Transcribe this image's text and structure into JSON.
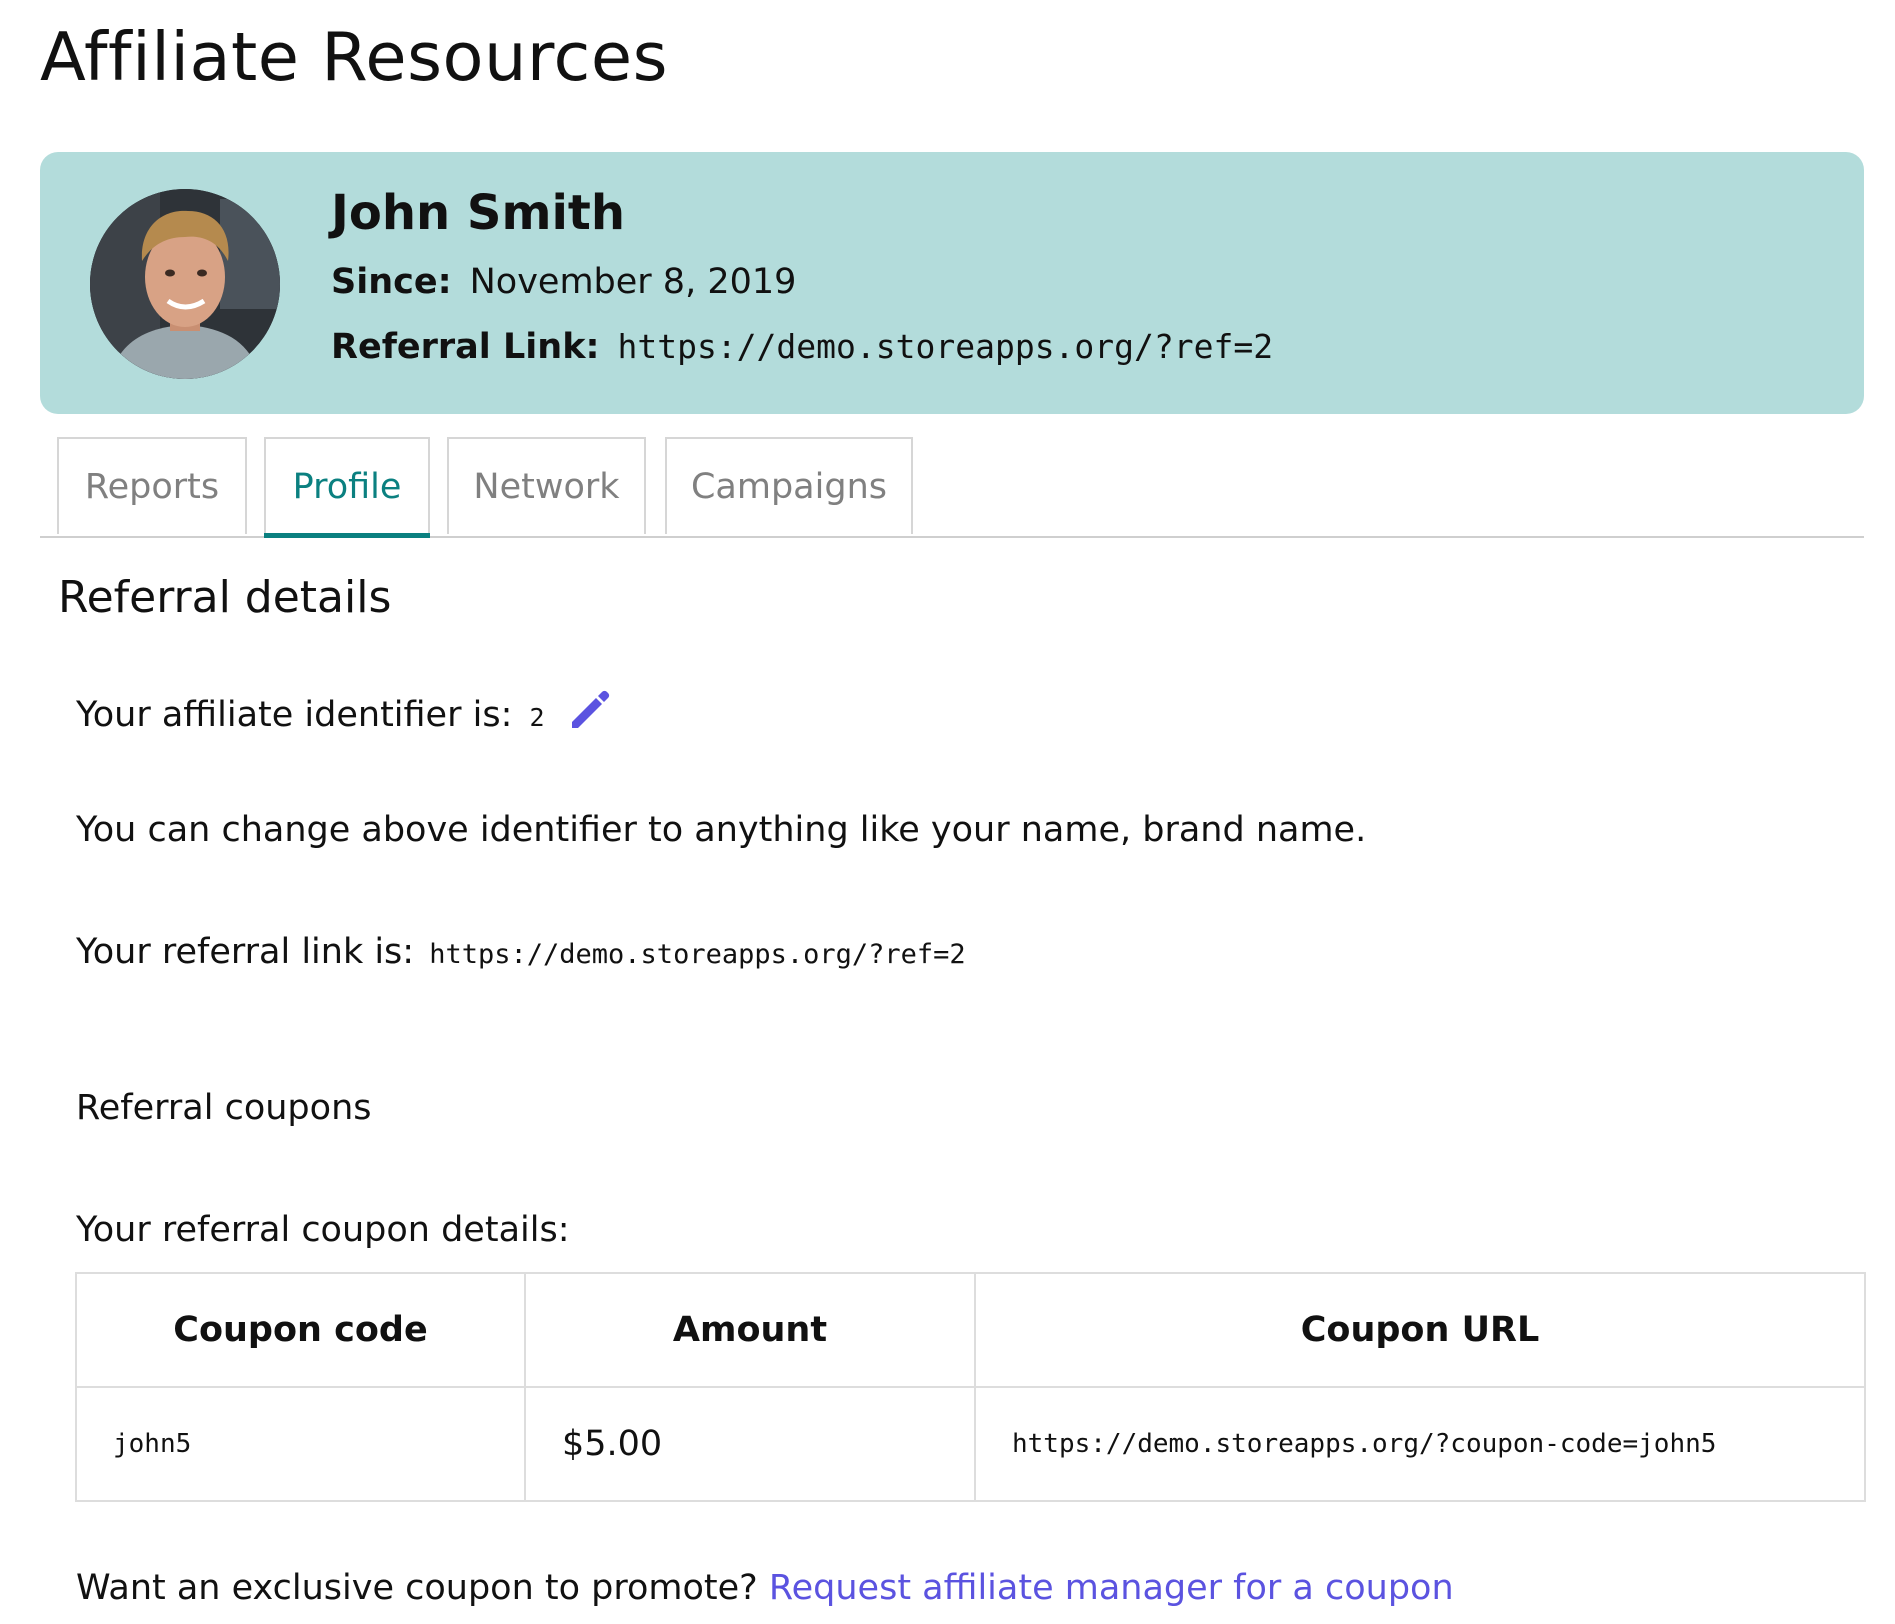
{
  "page": {
    "title": "Affiliate Resources"
  },
  "profile": {
    "name": "John Smith",
    "since_label": "Since:",
    "since_value": "November 8, 2019",
    "link_label": "Referral Link:",
    "link_value": "https://demo.storeapps.org/?ref=2"
  },
  "tabs": [
    {
      "label": "Reports",
      "active": false
    },
    {
      "label": "Profile",
      "active": true
    },
    {
      "label": "Network",
      "active": false
    },
    {
      "label": "Campaigns",
      "active": false
    }
  ],
  "referral": {
    "section_title": "Referral details",
    "identifier_label": "Your affiliate identifier is:",
    "identifier_value": "2",
    "identifier_edit_icon": "pencil-icon",
    "change_note": "You can change above identifier to anything like your name, brand name.",
    "link_label": "Your referral link is:",
    "link_value": "https://demo.storeapps.org/?ref=2",
    "coupons_heading": "Referral coupons",
    "coupon_details_label": "Your referral coupon details:"
  },
  "coupon_table": {
    "headers": [
      "Coupon code",
      "Amount",
      "Coupon URL"
    ],
    "rows": [
      [
        "john5",
        "$5.00",
        "https://demo.storeapps.org/?coupon-code=john5"
      ]
    ]
  },
  "exclusive": {
    "question": "Want an exclusive coupon to promote?",
    "link_text": "Request affiliate manager for a coupon"
  },
  "colors": {
    "card_background": "#b3dcdb",
    "active_tab": "#0b8080",
    "link": "#5b53e0",
    "edit_icon": "#5b53e0"
  }
}
